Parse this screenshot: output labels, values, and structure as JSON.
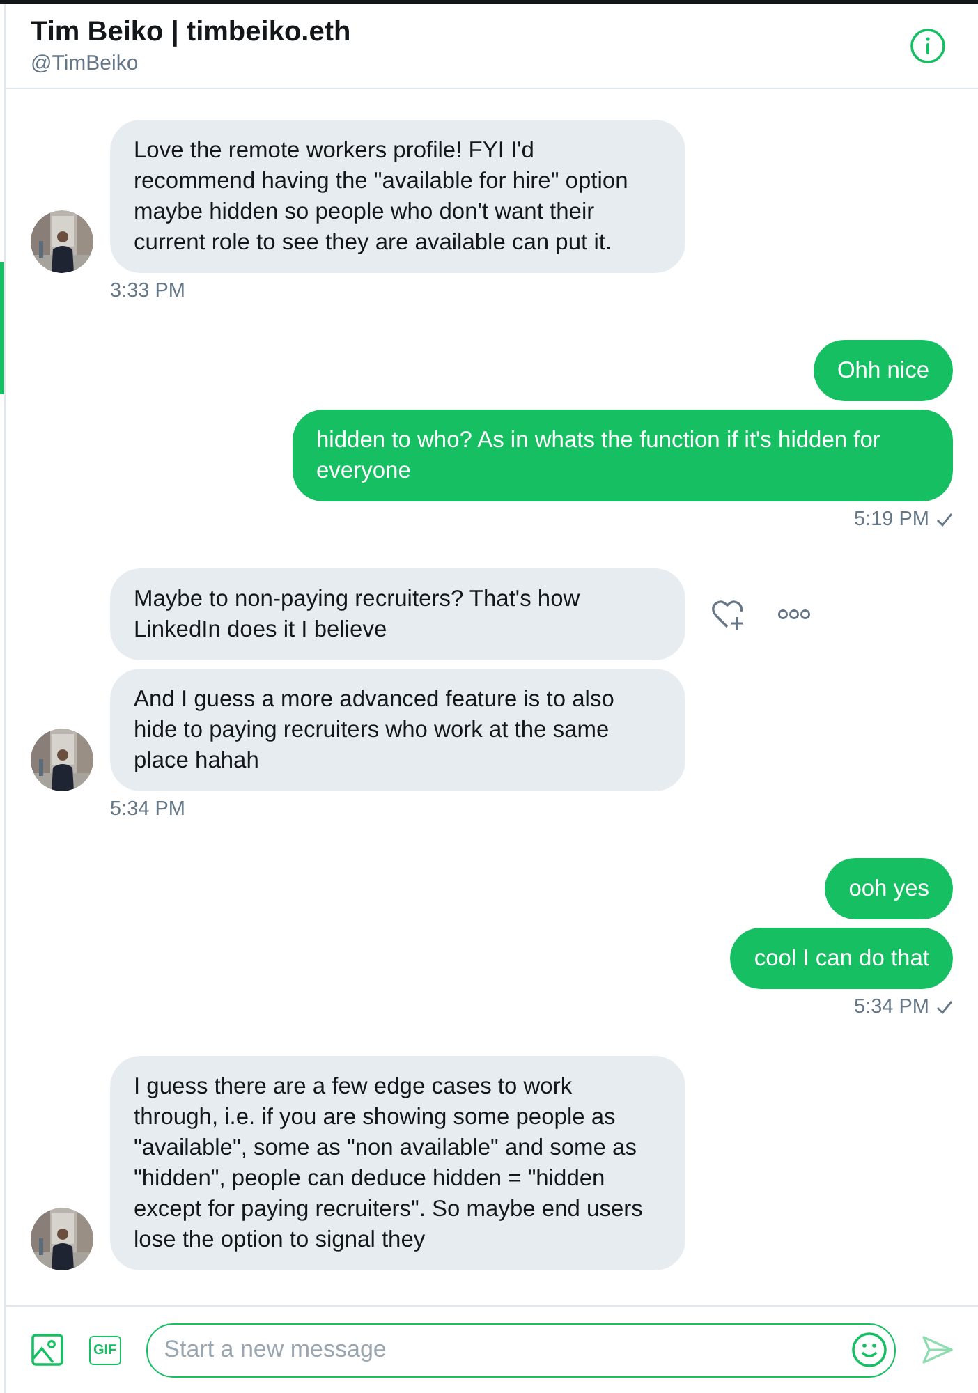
{
  "header": {
    "title": "Tim Beiko | timbeiko.eth",
    "handle": "@TimBeiko"
  },
  "groups": [
    {
      "kind": "received",
      "time": "3:33 PM",
      "messages": [
        {
          "text": "Love the remote workers profile! FYI I'd recommend having the \"available for hire\" option maybe hidden so people who don't want their current role to see they are available can put it.",
          "actions_shown": false
        }
      ]
    },
    {
      "kind": "sent",
      "time": "5:19 PM",
      "read": true,
      "messages": [
        {
          "text": "Ohh nice",
          "actions_shown": false
        },
        {
          "text": "hidden to who? As in whats the function if it's hidden for everyone",
          "actions_shown": false
        }
      ]
    },
    {
      "kind": "received",
      "time": "5:34 PM",
      "messages": [
        {
          "text": "Maybe to non-paying recruiters? That's how LinkedIn does it I believe",
          "actions_shown": true
        },
        {
          "text": "And I guess a more advanced feature is to also hide to paying recruiters who work at the same place hahah",
          "actions_shown": false
        }
      ]
    },
    {
      "kind": "sent",
      "time": "5:34 PM",
      "read": true,
      "messages": [
        {
          "text": "ooh yes",
          "actions_shown": false
        },
        {
          "text": "cool I can do that",
          "actions_shown": false
        }
      ]
    },
    {
      "kind": "received",
      "messages": [
        {
          "text": "I guess there are a few edge cases to work through, i.e. if you are showing some people as \"available\", some as \"non available\" and some as \"hidden\", people can deduce hidden = \"hidden except for paying recruiters\". So maybe end users lose the option to signal they",
          "actions_shown": false
        }
      ]
    }
  ],
  "composer": {
    "placeholder": "Start a new message",
    "gif_label": "GIF"
  }
}
